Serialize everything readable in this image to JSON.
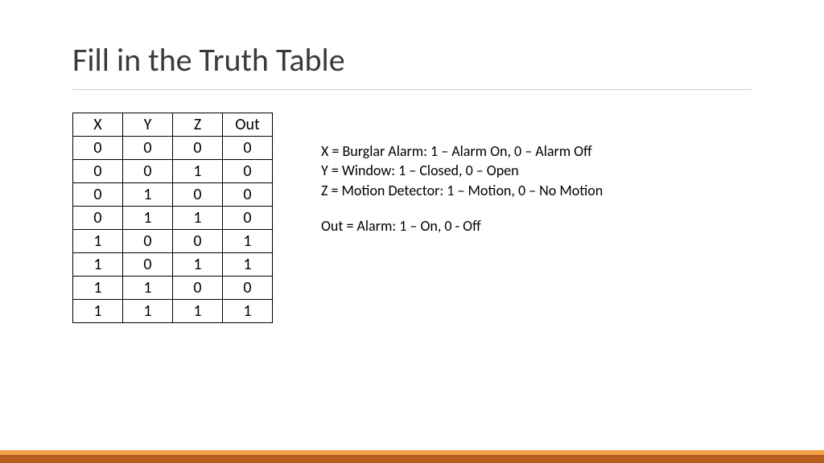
{
  "title": "Fill in the Truth Table",
  "table": {
    "headers": [
      "X",
      "Y",
      "Z",
      "Out"
    ],
    "rows": [
      [
        "0",
        "0",
        "0",
        "0"
      ],
      [
        "0",
        "0",
        "1",
        "0"
      ],
      [
        "0",
        "1",
        "0",
        "0"
      ],
      [
        "0",
        "1",
        "1",
        "0"
      ],
      [
        "1",
        "0",
        "0",
        "1"
      ],
      [
        "1",
        "0",
        "1",
        "1"
      ],
      [
        "1",
        "1",
        "0",
        "0"
      ],
      [
        "1",
        "1",
        "1",
        "1"
      ]
    ]
  },
  "legend": {
    "line1": "X = Burglar Alarm:  1 – Alarm On, 0 – Alarm Off",
    "line2": "Y = Window:  1 – Closed, 0 – Open",
    "line3": "Z = Motion Detector: 1 – Motion, 0 – No Motion",
    "line4": "Out = Alarm: 1 – On, 0 - Off"
  }
}
